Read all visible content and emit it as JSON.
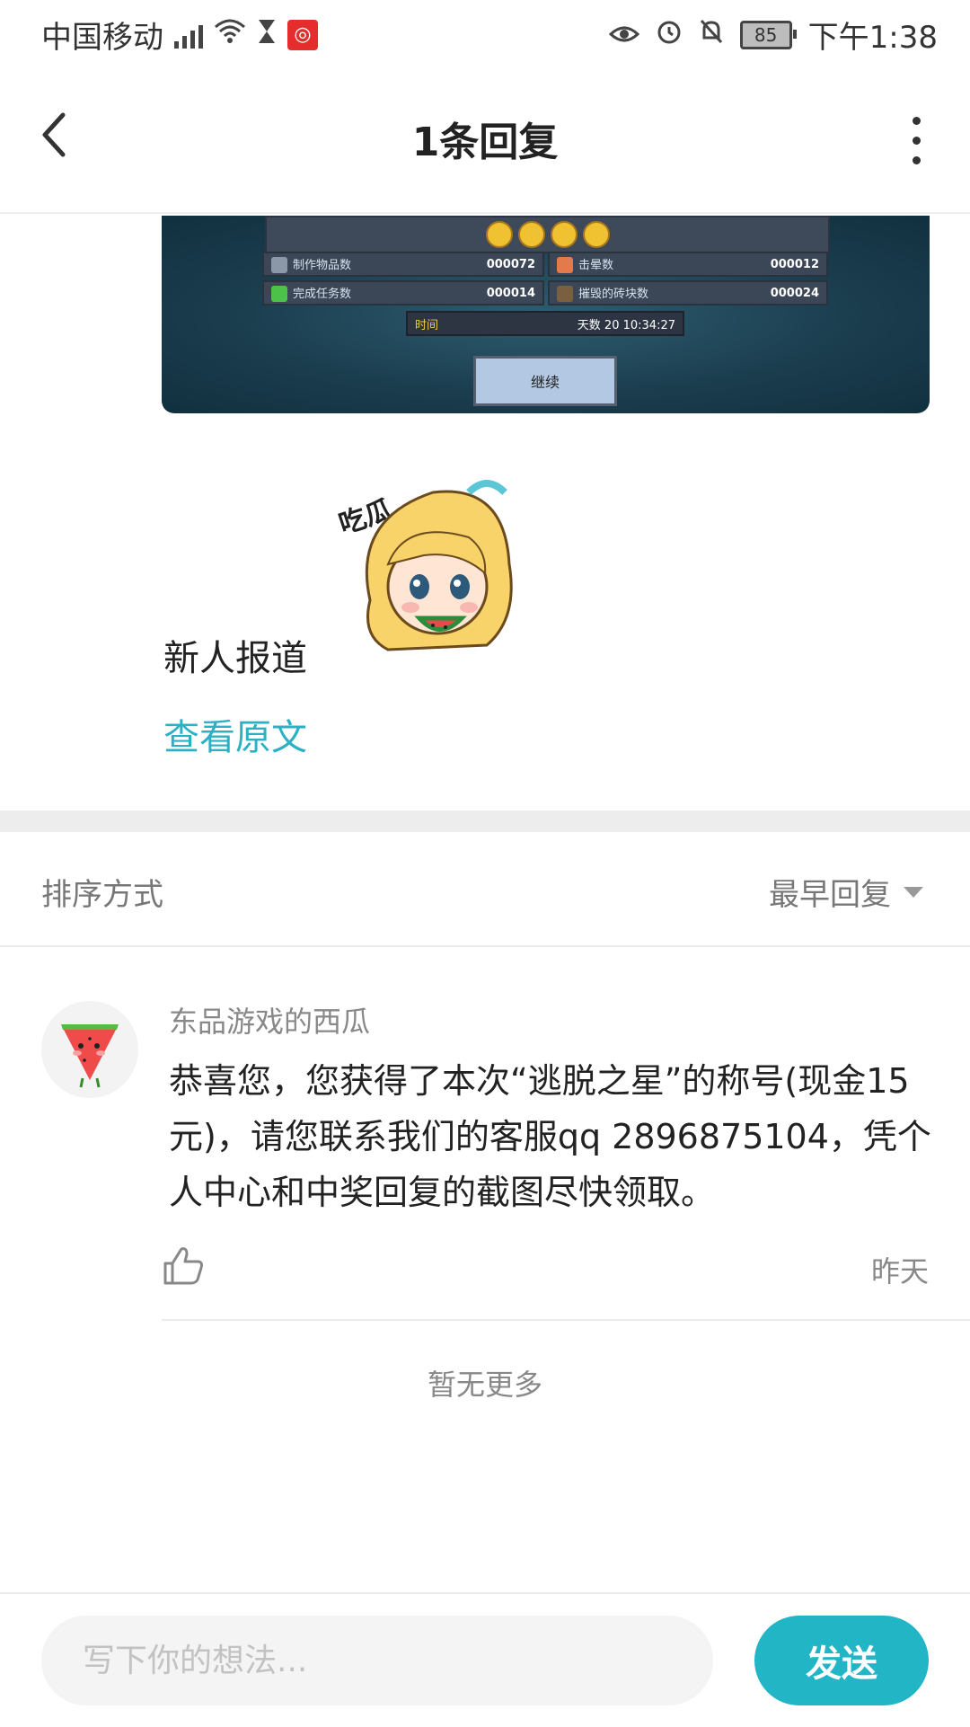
{
  "status_bar": {
    "carrier": "中国移动",
    "network": "2G",
    "battery": "85",
    "time": "下午1:38",
    "icons": [
      "signal-icon",
      "wifi-icon",
      "hourglass-icon",
      "netease-music-icon",
      "eye-icon",
      "alarm-icon",
      "mute-bell-icon",
      "battery-icon"
    ]
  },
  "header": {
    "title": "1条回复",
    "icons": [
      "back-arrow-icon",
      "more-vertical-icon"
    ]
  },
  "game_screenshot": {
    "stats": [
      {
        "label": "制作物品数",
        "value": "000072"
      },
      {
        "label": "击晕数",
        "value": "000012"
      },
      {
        "label": "完成任务数",
        "value": "000014"
      },
      {
        "label": "摧毁的砖块数",
        "value": "000024"
      }
    ],
    "time_label": "时间",
    "time_value": "天数 20  10:34:27",
    "continue_label": "继续"
  },
  "post": {
    "text": "新人报道",
    "view_original": "查看原文"
  },
  "sort": {
    "label": "排序方式",
    "value": "最早回复"
  },
  "reply": {
    "username": "东品游戏的西瓜",
    "text": "恭喜您，您获得了本次“逃脱之星”的称号(现金15元)，请您联系我们的客服qq 2896875104，凭个人中心和中奖回复的截图尽快领取。",
    "time": "昨天"
  },
  "footer_note": "暂无更多",
  "composer": {
    "placeholder": "写下你的想法...",
    "send_label": "发送"
  },
  "colors": {
    "accent": "#22b5c6",
    "link": "#2bb0c4"
  }
}
